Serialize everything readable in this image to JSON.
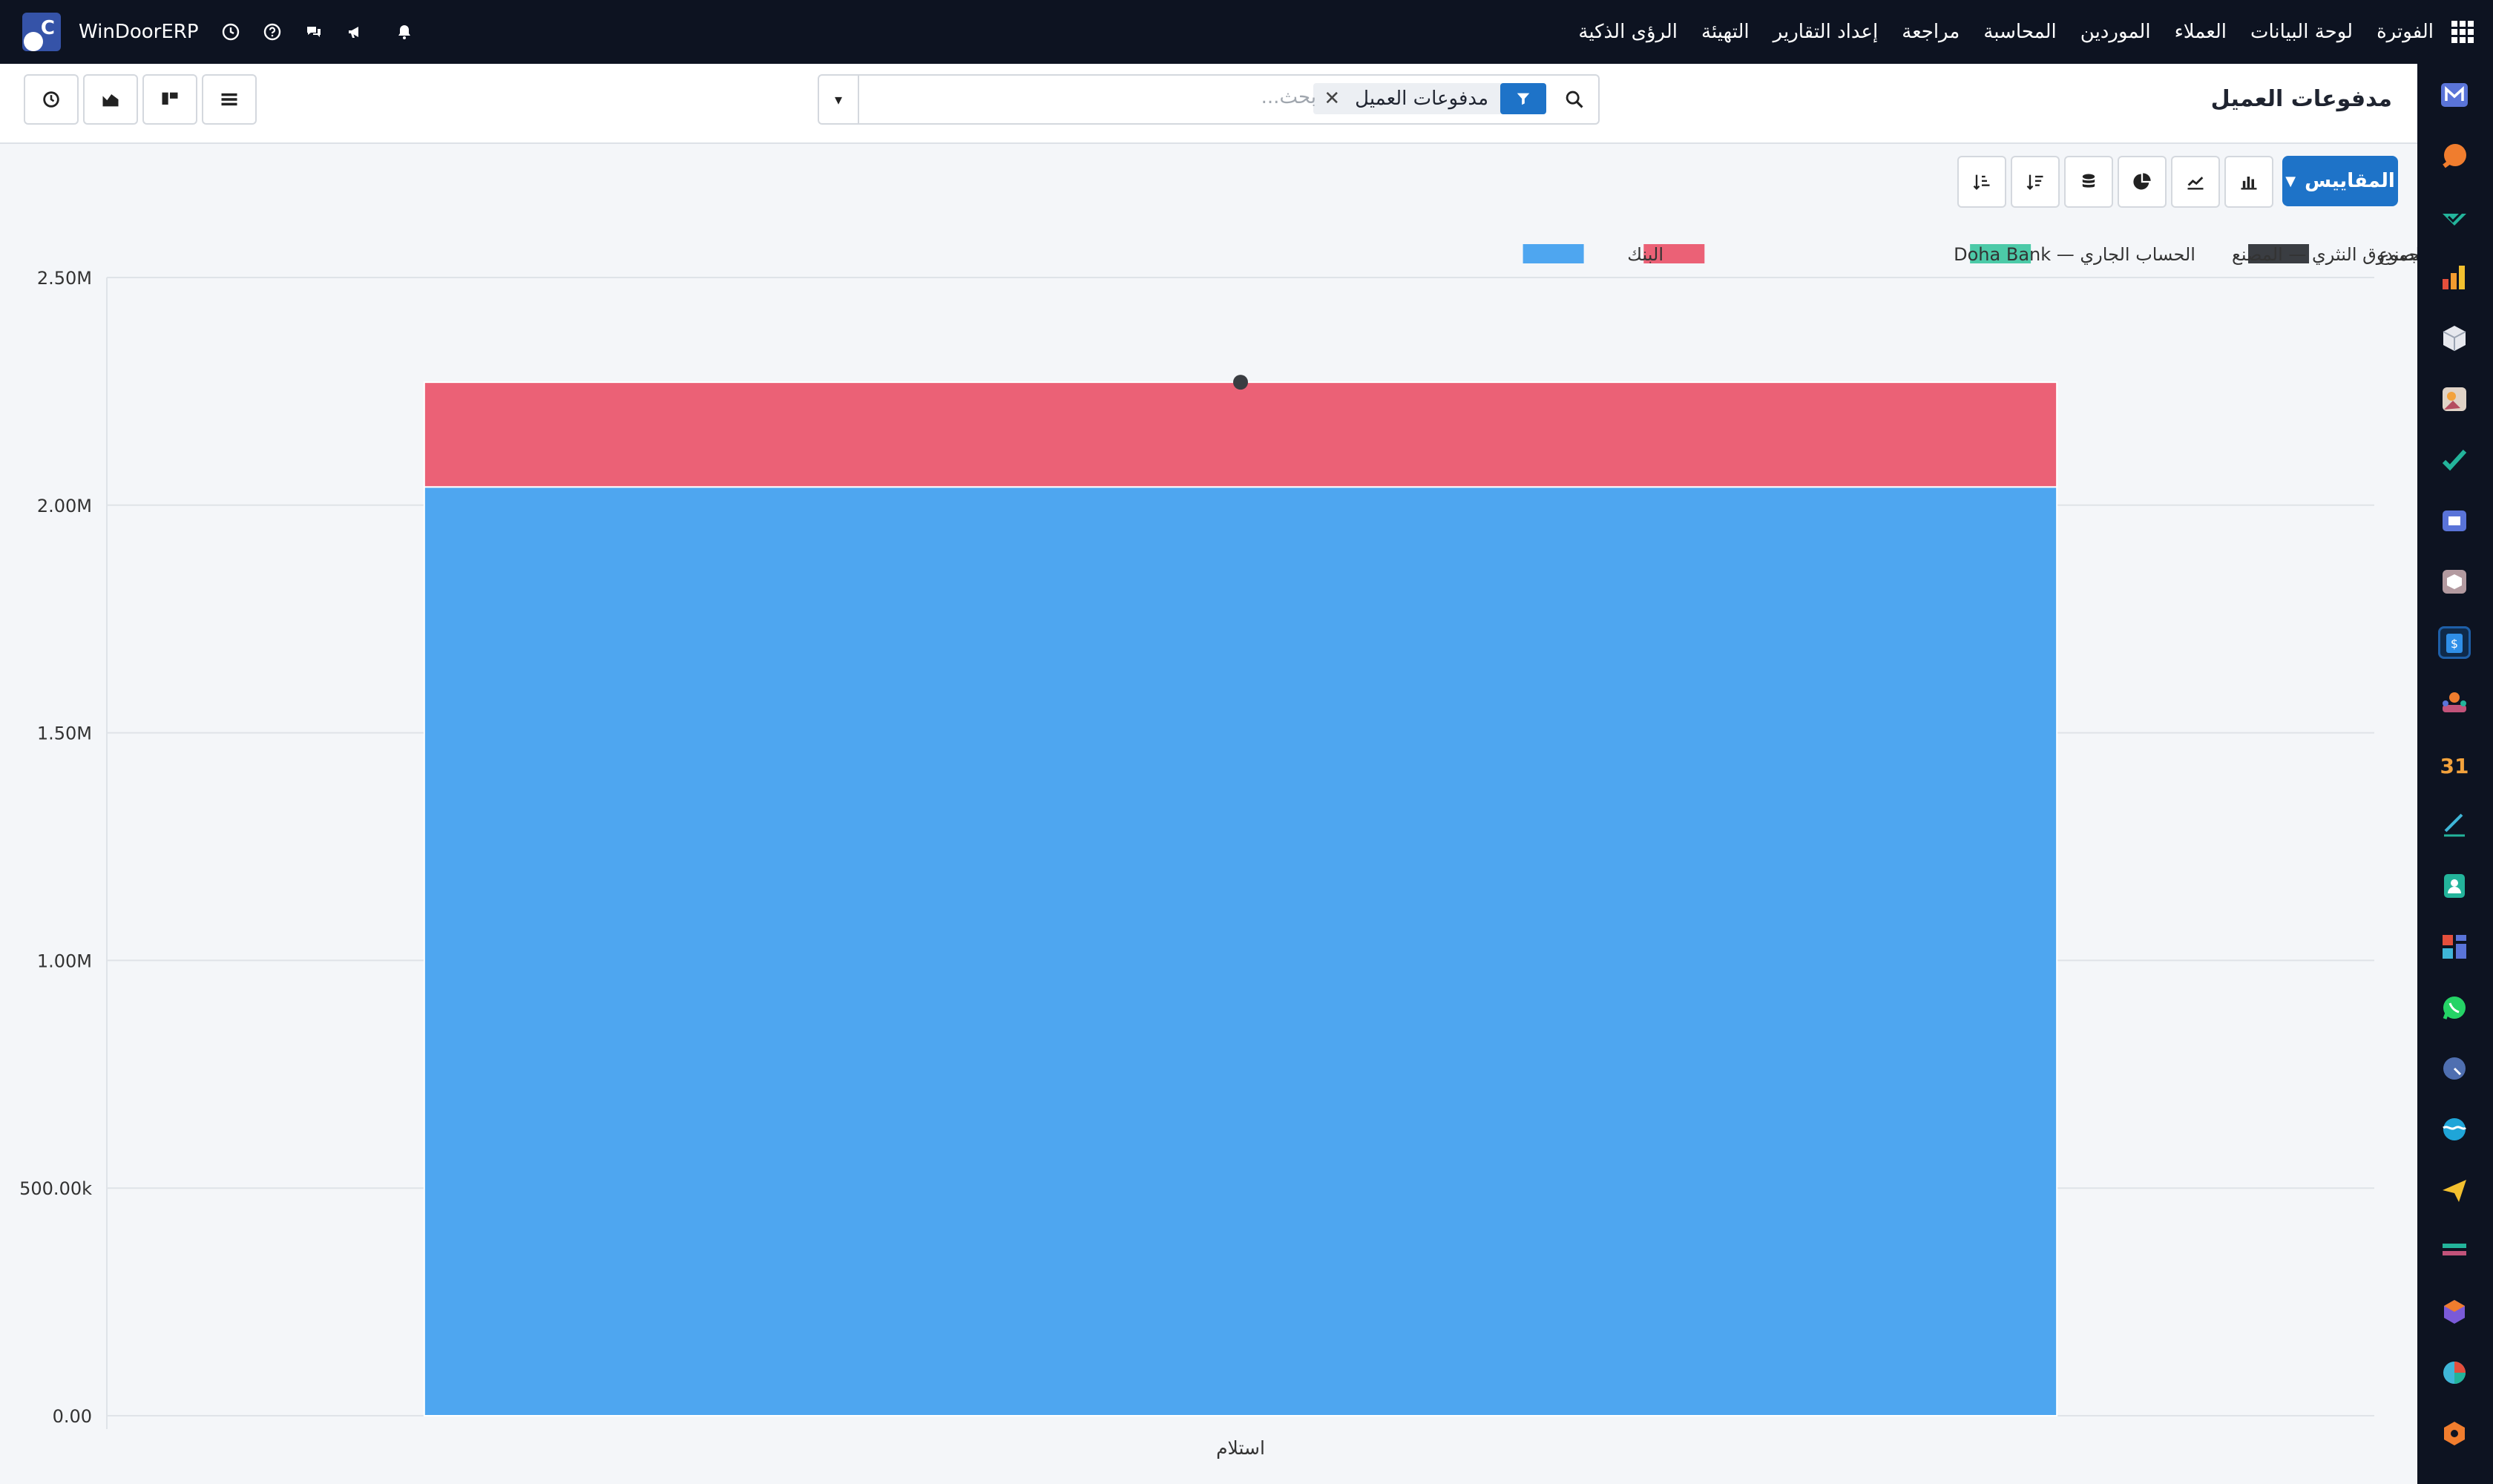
{
  "topbar": {
    "brand": "WinDoorERP",
    "logo_letter": "C",
    "nav": [
      "الفوترة",
      "لوحة البيانات",
      "العملاء",
      "الموردين",
      "المحاسبة",
      "مراجعة",
      "إعداد التقارير",
      "التهيئة",
      "الرؤى الذكية"
    ]
  },
  "page": {
    "title": "مدفوعات العميل"
  },
  "search": {
    "facet_label": "مدفوعات العميل",
    "placeholder": "بحث..."
  },
  "toolbar": {
    "measures_label": "المقاييس"
  },
  "colors": {
    "accent": "#1e73c8",
    "nav_bg": "#0d1321",
    "bank": "#4ea6f0",
    "doha": "#eb6176",
    "factory": "#4ccaa8",
    "total": "#3a3d42"
  },
  "chart_data": {
    "type": "bar",
    "stacked": true,
    "categories": [
      "استلام"
    ],
    "series": [
      {
        "name": "البنك",
        "values": [
          2040000
        ],
        "color": "#4ea6f0"
      },
      {
        "name": "الحساب الجاري — Doha Bank",
        "values": [
          230000
        ],
        "color": "#eb6176"
      },
      {
        "name": "الصندوق النثري — المصنع",
        "values": [
          0
        ],
        "color": "#4ccaa8"
      },
      {
        "name": "المجموع",
        "values": [
          2270000
        ],
        "color": "#3a3d42",
        "type": "point"
      }
    ],
    "yticks": [
      "0.00",
      "500.00k",
      "1.00M",
      "1.50M",
      "2.00M",
      "2.50M"
    ],
    "ylim": [
      0,
      2500000
    ],
    "grid": true,
    "legend_position": "top-right"
  }
}
